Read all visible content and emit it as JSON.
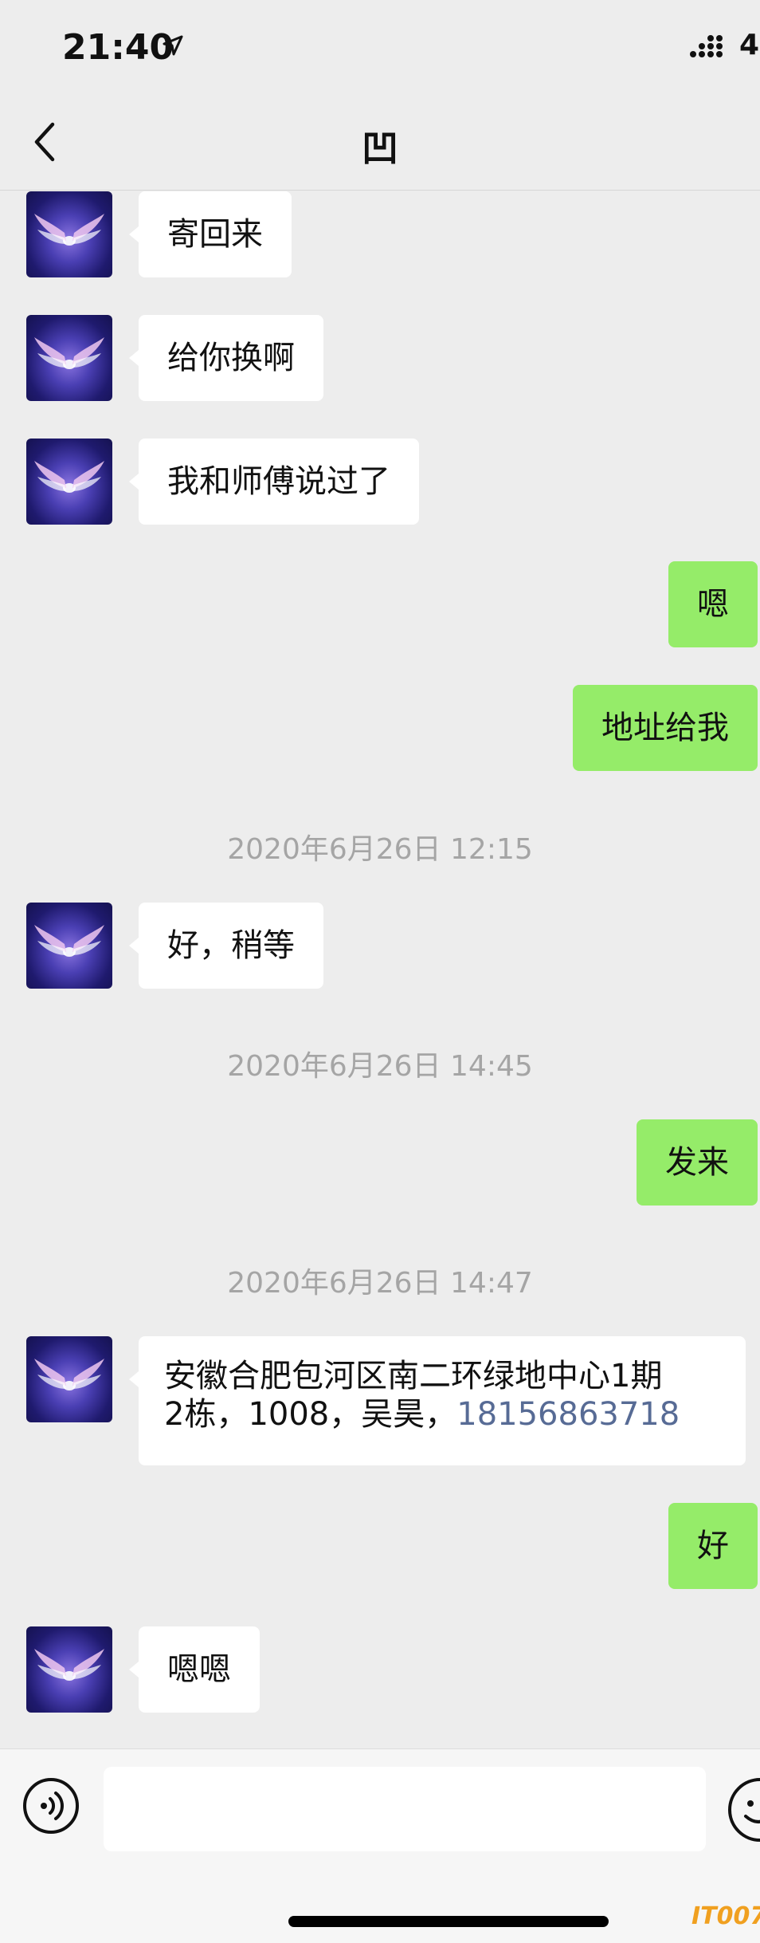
{
  "status_bar": {
    "time": "21:40",
    "battery_partial": "4"
  },
  "nav": {
    "title": "凹"
  },
  "messages": [
    {
      "text": "寄回来"
    },
    {
      "text": "给你换啊"
    },
    {
      "text": "我和师傅说过了"
    },
    {
      "text": "嗯"
    },
    {
      "text": "地址给我"
    },
    {
      "timestamp": "2020年6月26日 12:15"
    },
    {
      "text": "好，稍等"
    },
    {
      "timestamp": "2020年6月26日 14:45"
    },
    {
      "text": "发来"
    },
    {
      "timestamp": "2020年6月26日 14:47"
    },
    {
      "line1": "安徽合肥包河区南二环绿地中心1期",
      "line2_prefix": "2栋，1008，吴昊，",
      "phone": "18156863718"
    },
    {
      "text": "好"
    },
    {
      "text": "嗯嗯"
    }
  ],
  "watermark": "IT007",
  "colors": {
    "background": "#ededed",
    "incoming_bubble": "#ffffff",
    "outgoing_bubble": "#95ec69",
    "link": "#576b95"
  }
}
